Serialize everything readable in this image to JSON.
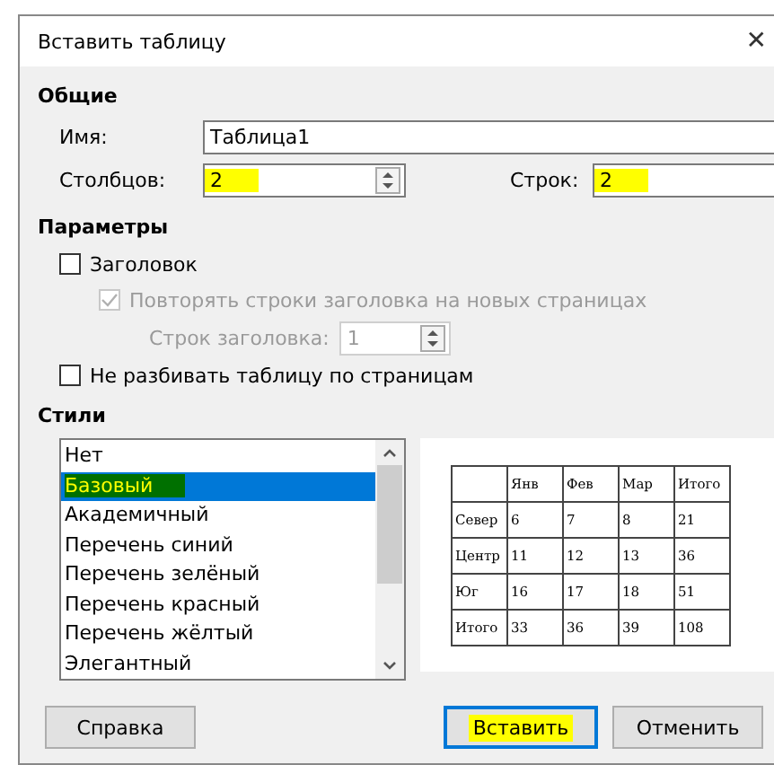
{
  "window": {
    "title": "Вставить таблицу",
    "close": "✕"
  },
  "general": {
    "heading": "Общие",
    "name_label": "Имя:",
    "name_value": "Таблица1",
    "columns_label": "Столбцов:",
    "columns_value": "2",
    "columns_highlighted": true,
    "rows_label": "Строк:",
    "rows_value": "2",
    "rows_highlighted": true
  },
  "options": {
    "heading": "Параметры",
    "items": [
      {
        "kind": "check",
        "label": "Заголовок",
        "checked": false,
        "disabled": false
      },
      {
        "kind": "check",
        "label": "Повторять строки заголовка на новых страницах",
        "checked": true,
        "disabled": true
      },
      {
        "kind": "spin",
        "label": "Строк заголовка:",
        "value": "1",
        "disabled": true
      },
      {
        "kind": "check",
        "label": "Не разбивать таблицу по страницам",
        "checked": false,
        "disabled": false
      }
    ]
  },
  "styles": {
    "heading": "Стили",
    "items": [
      {
        "label": "Нет",
        "selected": false,
        "highlighted": false
      },
      {
        "label": "Базовый",
        "selected": true,
        "highlighted": true
      },
      {
        "label": "Академичный",
        "selected": false,
        "highlighted": false
      },
      {
        "label": "Перечень синий",
        "selected": false,
        "highlighted": false
      },
      {
        "label": "Перечень зелёный",
        "selected": false,
        "highlighted": false
      },
      {
        "label": "Перечень красный",
        "selected": false,
        "highlighted": false
      },
      {
        "label": "Перечень жёлтый",
        "selected": false,
        "highlighted": false
      },
      {
        "label": "Элегантный",
        "selected": false,
        "highlighted": false
      }
    ],
    "preview": {
      "header": [
        "Янв",
        "Фев",
        "Мар",
        "Итого"
      ],
      "rows": [
        {
          "label": "Север",
          "values": [
            "6",
            "7",
            "8",
            "21"
          ]
        },
        {
          "label": "Центр",
          "values": [
            "11",
            "12",
            "13",
            "36"
          ]
        },
        {
          "label": "Юг",
          "values": [
            "16",
            "17",
            "18",
            "51"
          ]
        },
        {
          "label": "Итого",
          "values": [
            "33",
            "36",
            "39",
            "108"
          ]
        }
      ]
    }
  },
  "buttons": [
    {
      "label": "Справка",
      "default": false,
      "highlighted": false
    },
    {
      "label": "Вставить",
      "default": true,
      "highlighted": true
    },
    {
      "label": "Отменить",
      "default": false,
      "highlighted": false
    }
  ]
}
